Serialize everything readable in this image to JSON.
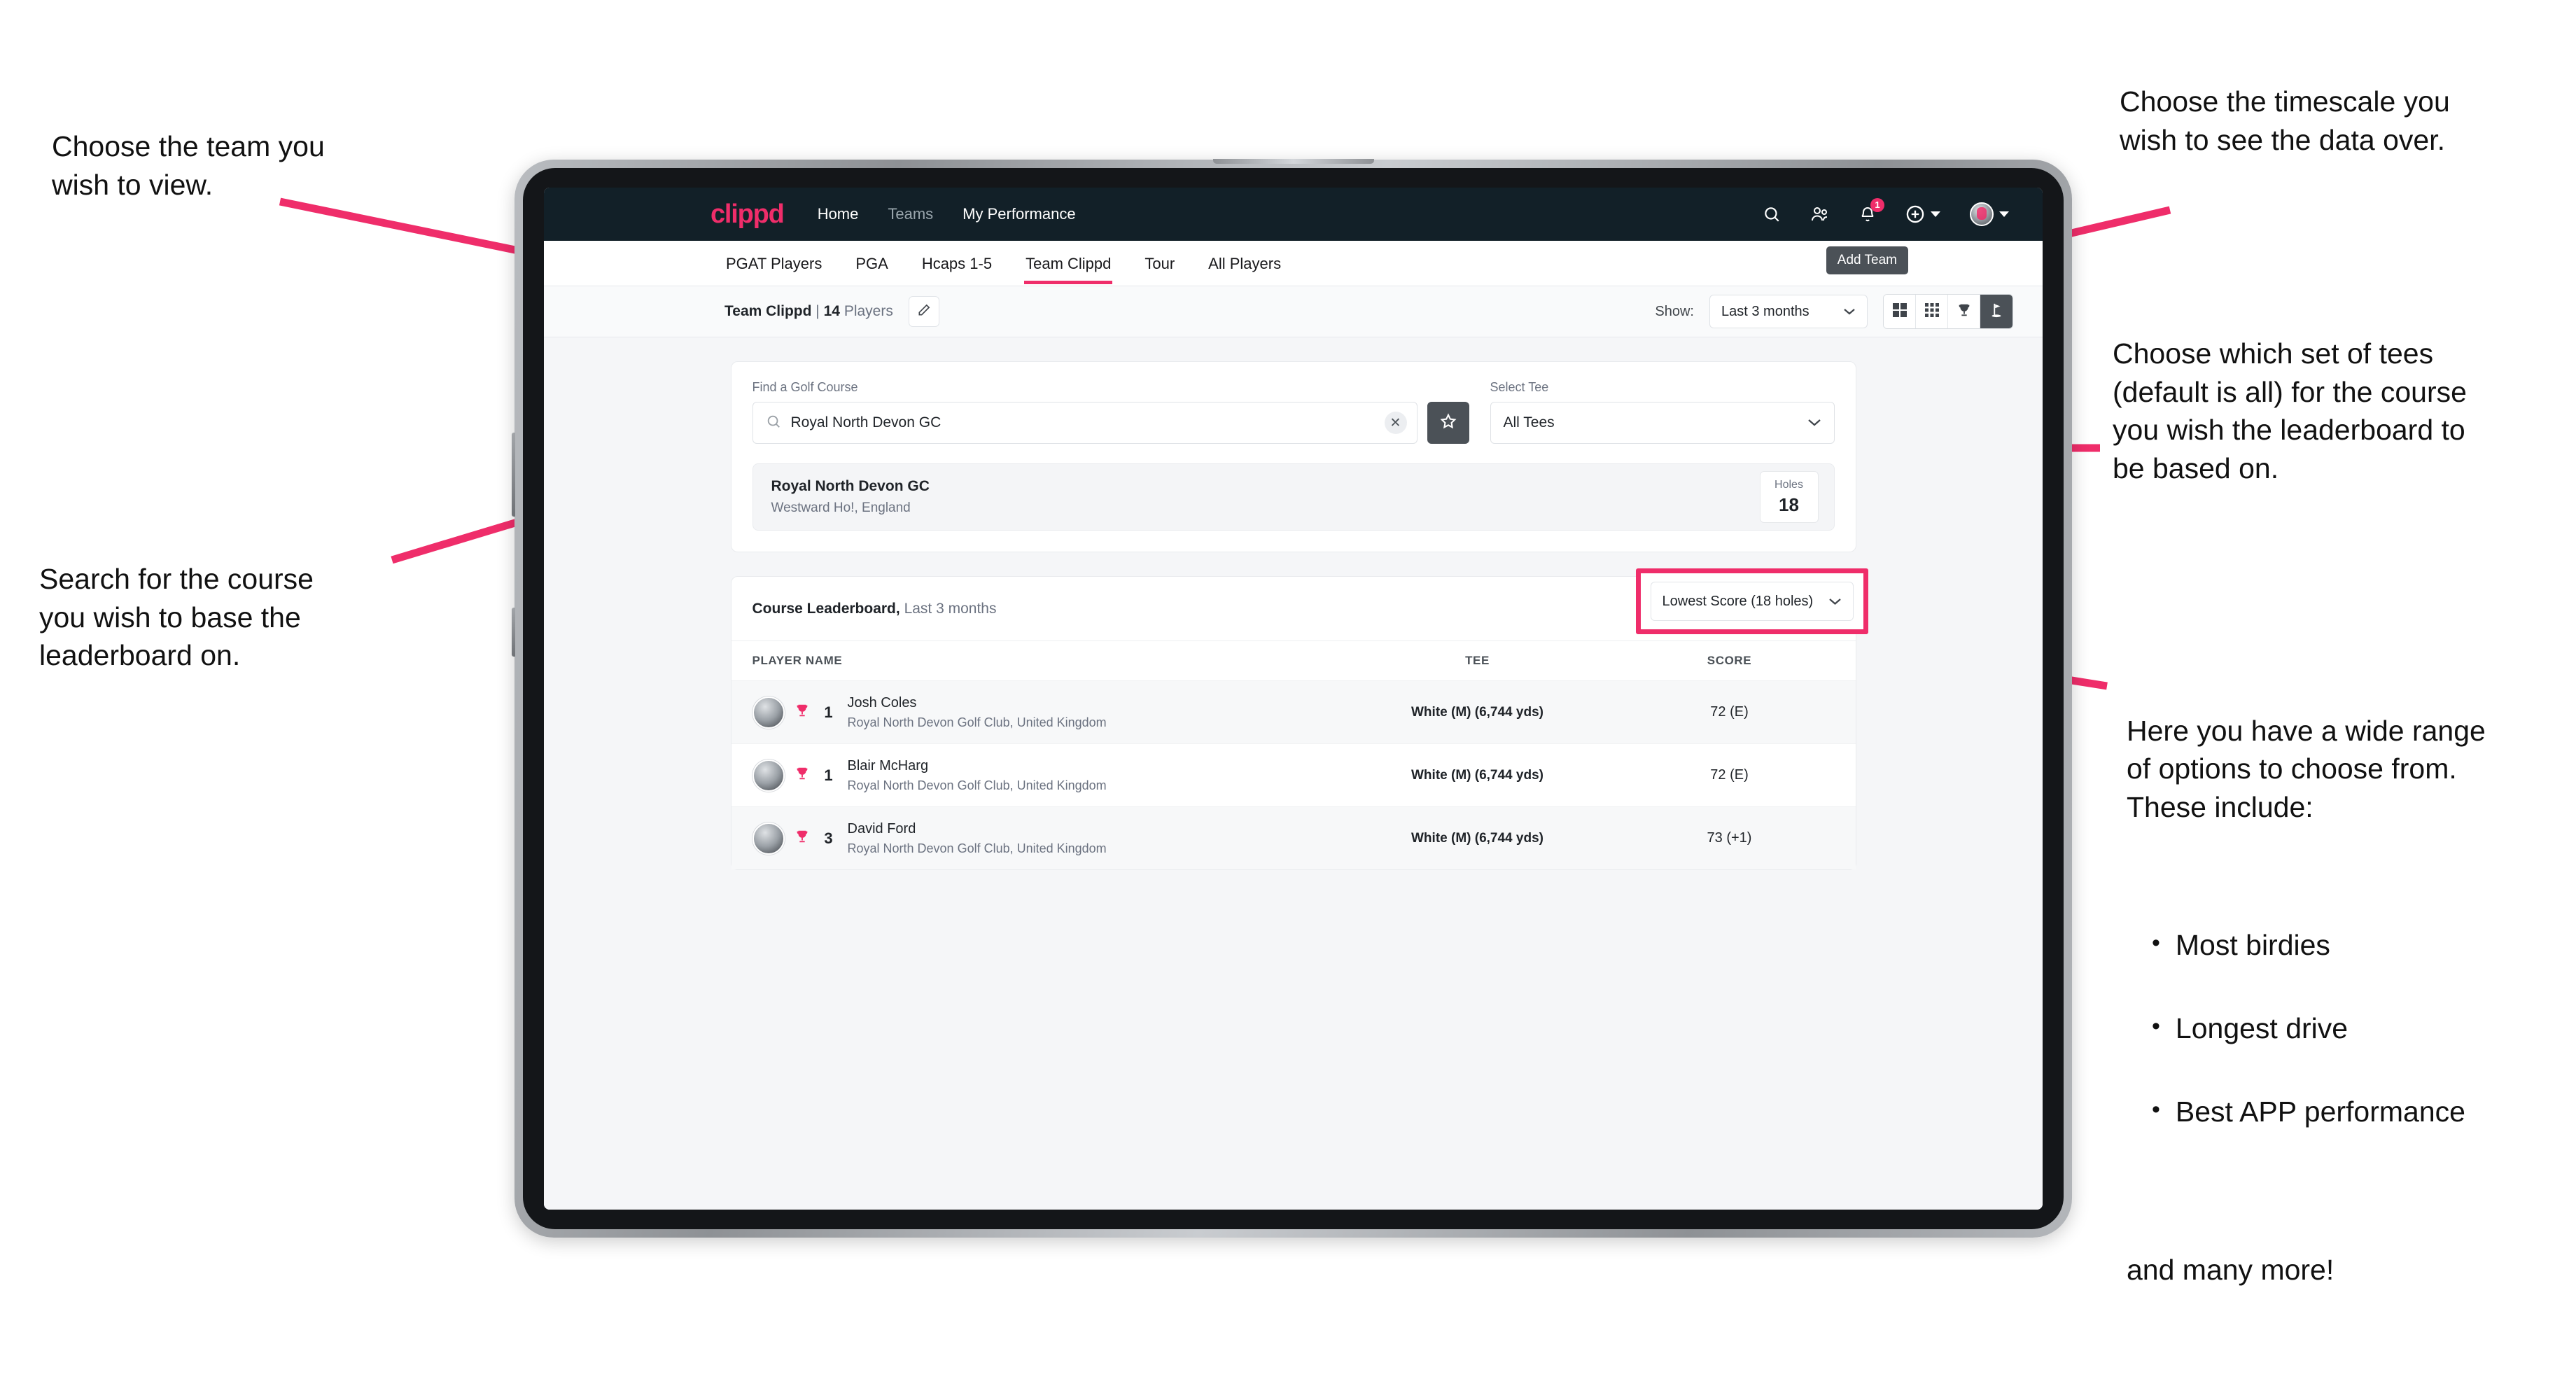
{
  "annotations": {
    "team": "Choose the team you\nwish to view.",
    "timescale": "Choose the timescale you\nwish to see the data over.",
    "tees": "Choose which set of tees\n(default is all) for the course\nyou wish the leaderboard to\nbe based on.",
    "search": "Search for the course\nyou wish to base the\nleaderboard on.",
    "options_intro": "Here you have a wide range\nof options to choose from.\nThese include:",
    "options_list": [
      "Most birdies",
      "Longest drive",
      "Best APP performance"
    ],
    "options_tail": "and many more!"
  },
  "app": {
    "brand": "clippd",
    "nav_links": [
      {
        "label": "Home",
        "dim": false
      },
      {
        "label": "Teams",
        "dim": true
      },
      {
        "label": "My Performance",
        "dim": false
      }
    ],
    "nav_icons": [
      "search-icon",
      "people-icon",
      "bell-icon",
      "plus-circle-icon",
      "avatar-icon"
    ],
    "notification_count": "1",
    "tooltip": "Add Team",
    "tabs": [
      {
        "label": "PGAT Players",
        "active": false,
        "dim": false
      },
      {
        "label": "PGA",
        "active": false,
        "dim": false
      },
      {
        "label": "Hcaps 1-5",
        "active": false,
        "dim": false
      },
      {
        "label": "Team Clippd",
        "active": true,
        "dim": true
      },
      {
        "label": "Tour",
        "active": false,
        "dim": false
      },
      {
        "label": "All Players",
        "active": false,
        "dim": false
      }
    ],
    "team_bar": {
      "team_name": "Team Clippd",
      "separator": "|",
      "player_count": "14",
      "players_word": "Players",
      "edit_icon": "pencil-icon",
      "show_label": "Show:",
      "show_value": "Last 3 months",
      "view_toggles": [
        {
          "icon": "grid-2x2-icon",
          "active": false
        },
        {
          "icon": "grid-3x3-icon",
          "active": false
        },
        {
          "icon": "trophy-icon",
          "active": false
        },
        {
          "icon": "golf-flag-icon",
          "active": true
        }
      ]
    },
    "search_panel": {
      "course_label": "Find a Golf Course",
      "course_value": "Royal North Devon GC",
      "course_placeholder": "Find a Golf Course",
      "search_icon": "search-icon",
      "clear_icon": "close-icon",
      "favorite_icon": "star-icon",
      "tee_label": "Select Tee",
      "tee_value": "All Tees"
    },
    "course_result": {
      "name": "Royal North Devon GC",
      "location": "Westward Ho!, England",
      "holes_label": "Holes",
      "holes_value": "18"
    },
    "leaderboard": {
      "title": "Course Leaderboard,",
      "subtitle": "Last 3 months",
      "metric_value": "Lowest Score (18 holes)",
      "columns": {
        "player": "PLAYER NAME",
        "tee": "TEE",
        "score": "SCORE"
      },
      "rows": [
        {
          "rank": "1",
          "name": "Josh Coles",
          "club": "Royal North Devon Golf Club, United Kingdom",
          "tee": "White (M) (6,744 yds)",
          "score": "72 (E)"
        },
        {
          "rank": "1",
          "name": "Blair McHarg",
          "club": "Royal North Devon Golf Club, United Kingdom",
          "tee": "White (M) (6,744 yds)",
          "score": "72 (E)"
        },
        {
          "rank": "3",
          "name": "David Ford",
          "club": "Royal North Devon Golf Club, United Kingdom",
          "tee": "White (M) (6,744 yds)",
          "score": "73 (+1)"
        }
      ]
    }
  },
  "colors": {
    "accent": "#ef2d6a",
    "navbar": "#122028",
    "dark_button": "#4b5157",
    "page_bg": "#f5f6f8"
  }
}
